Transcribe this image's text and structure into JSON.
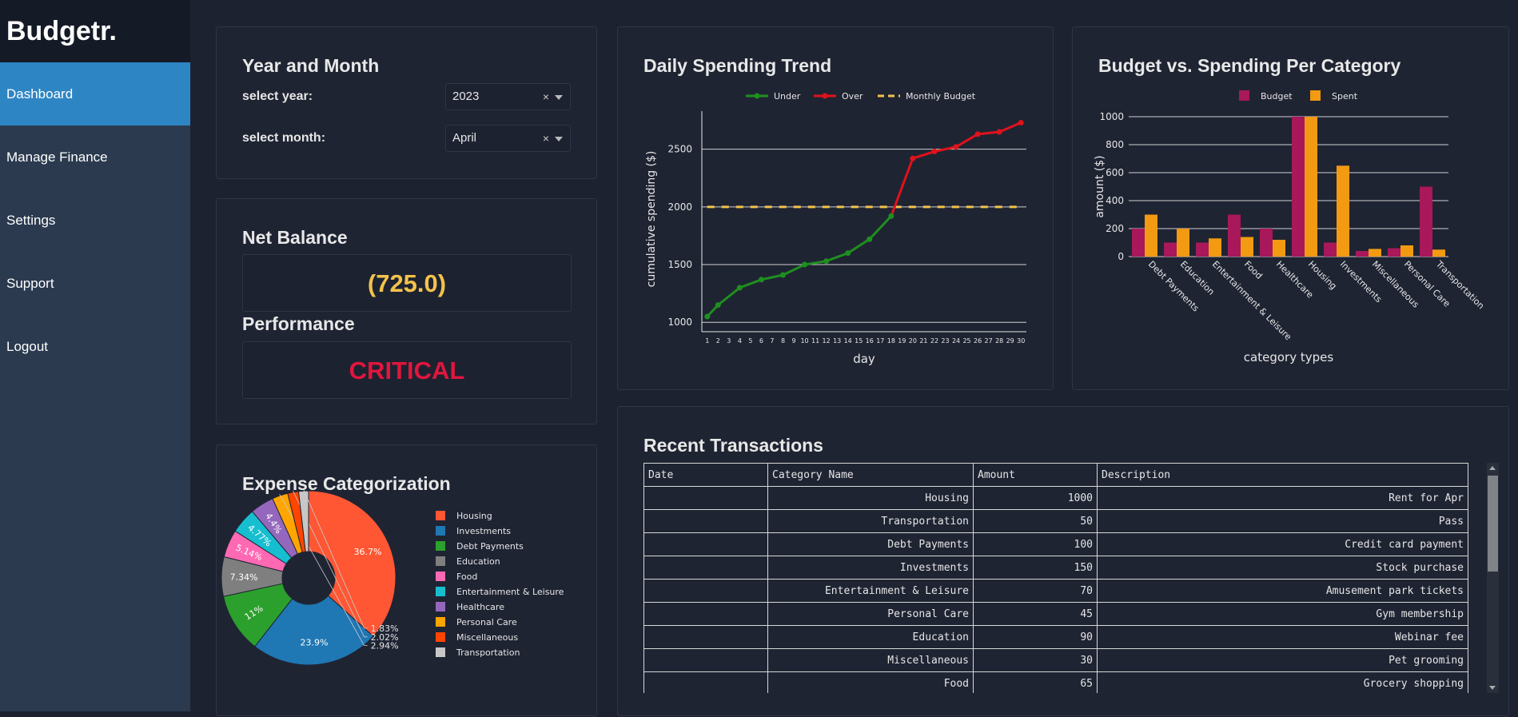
{
  "app": {
    "brand": "Budgetr."
  },
  "nav": {
    "items": [
      "Dashboard",
      "Manage Finance",
      "Settings",
      "Support",
      "Logout"
    ]
  },
  "year_month": {
    "title": "Year and Month",
    "year_label": "select year:",
    "year_value": "2023",
    "month_label": "select month:",
    "month_value": "April",
    "clear_glyph": "×"
  },
  "balance": {
    "net_title": "Net Balance",
    "net_value": "(725.0)",
    "net_color": "#f2c24a",
    "perf_title": "Performance",
    "perf_value": "CRITICAL",
    "perf_color": "#e0163e"
  },
  "expense_card": {
    "title": "Expense Categorization"
  },
  "trend_card": {
    "title": "Daily Spending Trend"
  },
  "budget_card": {
    "title": "Budget vs. Spending Per Category"
  },
  "transactions": {
    "title": "Recent Transactions",
    "columns": [
      "Date",
      "Category Name",
      "Amount",
      "Description"
    ],
    "rows": [
      [
        "",
        "Housing",
        "1000",
        "Rent for Apr"
      ],
      [
        "",
        "Transportation",
        "50",
        "Pass"
      ],
      [
        "",
        "Debt Payments",
        "100",
        "Credit card payment"
      ],
      [
        "",
        "Investments",
        "150",
        "Stock purchase"
      ],
      [
        "",
        "Entertainment & Leisure",
        "70",
        "Amusement park tickets"
      ],
      [
        "",
        "Personal Care",
        "45",
        "Gym membership"
      ],
      [
        "",
        "Education",
        "90",
        "Webinar fee"
      ],
      [
        "",
        "Miscellaneous",
        "30",
        "Pet grooming"
      ],
      [
        "",
        "Food",
        "65",
        "Grocery shopping"
      ]
    ]
  },
  "chart_data": [
    {
      "type": "pie",
      "title": "Expense Categorization",
      "hole": true,
      "slices": [
        {
          "label": "Housing",
          "percent": 36.7,
          "color": "#ff5733"
        },
        {
          "label": "Investments",
          "percent": 23.9,
          "color": "#1f77b4"
        },
        {
          "label": "Debt Payments",
          "percent": 11,
          "color": "#2ca02c"
        },
        {
          "label": "Education",
          "percent": 7.34,
          "color": "#7f7f7f"
        },
        {
          "label": "Food",
          "percent": 5.14,
          "color": "#ff69b4"
        },
        {
          "label": "Entertainment & Leisure",
          "percent": 4.77,
          "color": "#17becf"
        },
        {
          "label": "Healthcare",
          "percent": 4.4,
          "color": "#9467bd"
        },
        {
          "label": "Personal Care",
          "percent": 2.94,
          "color": "#ffa500"
        },
        {
          "label": "Miscellaneous",
          "percent": 2.02,
          "color": "#ff4500"
        },
        {
          "label": "Transportation",
          "percent": 1.83,
          "color": "#c7c7c7"
        }
      ],
      "slice_labels": [
        "36.7%",
        "23.9%",
        "11%",
        "7.34%",
        "5.14%",
        "4.77%",
        "4.4%",
        "2.94%",
        "2.02%",
        "1.83%"
      ],
      "legend_placement": "right"
    },
    {
      "type": "line",
      "title": "Daily Spending Trend",
      "xlabel": "day",
      "ylabel": "cumulative spending ($)",
      "x": [
        1,
        2,
        4,
        6,
        8,
        10,
        12,
        14,
        16,
        18,
        20,
        22,
        24,
        26,
        28,
        30
      ],
      "y": [
        1050,
        1150,
        1300,
        1370,
        1410,
        1500,
        1530,
        1600,
        1720,
        1920,
        2420,
        2480,
        2520,
        2630,
        2650,
        2730
      ],
      "x_ticks": [
        1,
        2,
        3,
        4,
        5,
        6,
        7,
        8,
        9,
        10,
        11,
        12,
        13,
        14,
        15,
        16,
        17,
        18,
        19,
        20,
        21,
        22,
        23,
        24,
        25,
        26,
        27,
        28,
        29,
        30
      ],
      "y_ticks": [
        1000,
        1500,
        2000,
        2500
      ],
      "ylim": [
        960,
        2830
      ],
      "xlim": [
        0.5,
        30.5
      ],
      "budget": 2000,
      "series": [
        {
          "name": "Under",
          "color": "#1e8f1e"
        },
        {
          "name": "Over",
          "color": "#e0121b"
        },
        {
          "name": "Monthly Budget",
          "color": "#f2c24a",
          "dash": true
        }
      ],
      "grid": true,
      "legend_placement": "top"
    },
    {
      "type": "bar",
      "title": "Budget vs. Spending Per Category",
      "xlabel": "category types",
      "ylabel": "amount ($)",
      "categories": [
        "Debt Payments",
        "Education",
        "Entertainment & Leisure",
        "Food",
        "Healthcare",
        "Housing",
        "Investments",
        "Miscellaneous",
        "Personal Care",
        "Transportation"
      ],
      "series": [
        {
          "name": "Budget",
          "color": "#a8185a",
          "values": [
            200,
            100,
            100,
            300,
            200,
            1000,
            100,
            40,
            60,
            500
          ]
        },
        {
          "name": "Spent",
          "color": "#f29a11",
          "values": [
            300,
            200,
            130,
            140,
            120,
            1000,
            650,
            55,
            80,
            50
          ]
        }
      ],
      "y_ticks": [
        0,
        200,
        400,
        600,
        800,
        1000
      ],
      "ylim": [
        0,
        1000
      ],
      "grid": true,
      "legend_placement": "top"
    }
  ]
}
